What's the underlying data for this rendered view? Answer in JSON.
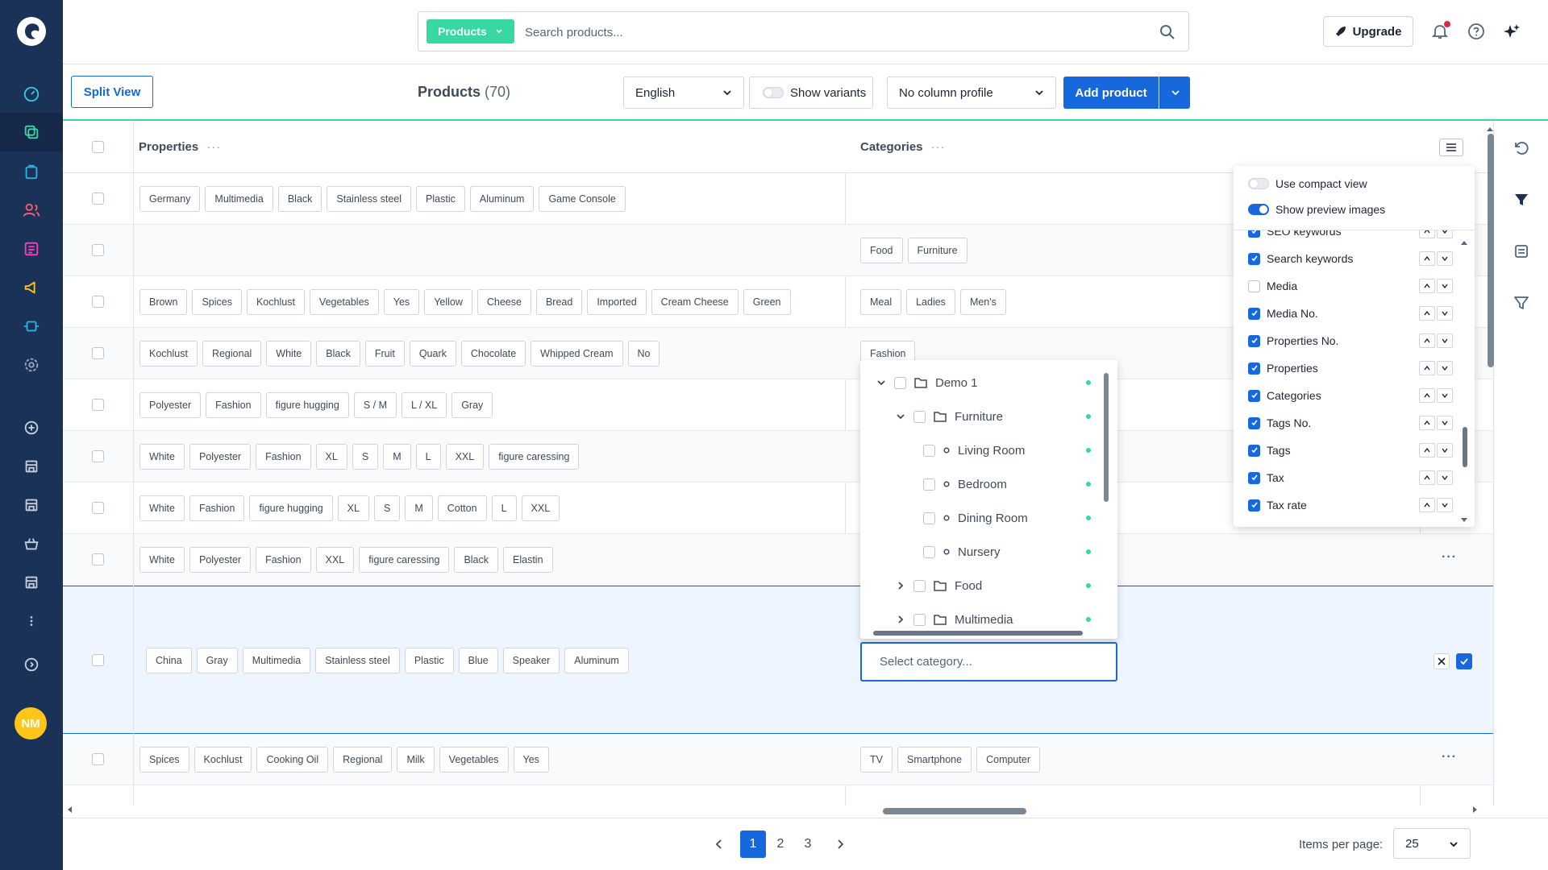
{
  "colors": {
    "sidebar": "#1a3258",
    "accent": "#1767dd",
    "green": "#37d8a1"
  },
  "avatar": {
    "initials": "NM"
  },
  "search": {
    "type_label": "Products",
    "placeholder": "Search products..."
  },
  "header": {
    "upgrade_label": "Upgrade"
  },
  "toolbar": {
    "split_view_label": "Split View",
    "title": "Products",
    "count": "(70)",
    "language": "English",
    "show_variants_label": "Show variants",
    "column_profile": "No column profile",
    "add_product_label": "Add product"
  },
  "grid": {
    "col_properties": "Properties",
    "col_categories": "Categories",
    "col_dots": "···",
    "row_dots": "···",
    "rows": [
      {
        "properties": [
          "Germany",
          "Multimedia",
          "Black",
          "Stainless steel",
          "Plastic",
          "Aluminum",
          "Game Console"
        ],
        "categories": []
      },
      {
        "properties": [],
        "categories": [
          "Food",
          "Furniture"
        ]
      },
      {
        "properties": [
          "Brown",
          "Spices",
          "Kochlust",
          "Vegetables",
          "Yes",
          "Yellow",
          "Cheese",
          "Bread",
          "Imported",
          "Cream Cheese",
          "Green"
        ],
        "categories": [
          "Meal",
          "Ladies",
          "Men's"
        ]
      },
      {
        "properties": [
          "Kochlust",
          "Regional",
          "White",
          "Black",
          "Fruit",
          "Quark",
          "Chocolate",
          "Whipped Cream",
          "No"
        ],
        "categories": [
          "Fashion"
        ]
      },
      {
        "properties": [
          "Polyester",
          "Fashion",
          "figure hugging",
          "S / M",
          "L / XL",
          "Gray"
        ],
        "categories": []
      },
      {
        "properties": [
          "White",
          "Polyester",
          "Fashion",
          "XL",
          "S",
          "M",
          "L",
          "XXL",
          "figure caressing"
        ],
        "categories": []
      },
      {
        "properties": [
          "White",
          "Fashion",
          "figure hugging",
          "XL",
          "S",
          "M",
          "Cotton",
          "L",
          "XXL"
        ],
        "categories": []
      },
      {
        "properties": [
          "White",
          "Polyester",
          "Fashion",
          "XXL",
          "figure caressing",
          "Black",
          "Elastin"
        ],
        "categories": []
      },
      {
        "properties": [
          "China",
          "Gray",
          "Multimedia",
          "Stainless steel",
          "Plastic",
          "Blue",
          "Speaker",
          "Aluminum"
        ],
        "categories": []
      },
      {
        "properties": [
          "Spices",
          "Kochlust",
          "Cooking Oil",
          "Regional",
          "Milk",
          "Vegetables",
          "Yes"
        ],
        "categories": [
          "TV",
          "Smartphone",
          "Computer"
        ]
      }
    ]
  },
  "category_select": {
    "placeholder": "Select category...",
    "tree": [
      {
        "label": "Demo 1",
        "level": 0,
        "expanded": true
      },
      {
        "label": "Furniture",
        "level": 1,
        "expanded": true
      },
      {
        "label": "Living Room",
        "level": 2
      },
      {
        "label": "Bedroom",
        "level": 2
      },
      {
        "label": "Dining Room",
        "level": 2
      },
      {
        "label": "Nursery",
        "level": 2
      },
      {
        "label": "Food",
        "level": 1,
        "expanded": false
      },
      {
        "label": "Multimedia",
        "level": 1,
        "expanded": false
      }
    ]
  },
  "column_settings": {
    "compact_view_label": "Use compact view",
    "compact_view_on": false,
    "preview_images_label": "Show preview images",
    "preview_images_on": true,
    "columns": [
      {
        "label": "SEO keywords",
        "checked": true
      },
      {
        "label": "Search keywords",
        "checked": true
      },
      {
        "label": "Media",
        "checked": false
      },
      {
        "label": "Media No.",
        "checked": true
      },
      {
        "label": "Properties No.",
        "checked": true
      },
      {
        "label": "Properties",
        "checked": true
      },
      {
        "label": "Categories",
        "checked": true
      },
      {
        "label": "Tags No.",
        "checked": true
      },
      {
        "label": "Tags",
        "checked": true
      },
      {
        "label": "Tax",
        "checked": true
      },
      {
        "label": "Tax rate",
        "checked": true
      }
    ]
  },
  "pagination": {
    "pages": [
      "1",
      "2",
      "3"
    ],
    "active_page": "1",
    "items_per_page_label": "Items per page:",
    "items_per_page": "25"
  }
}
